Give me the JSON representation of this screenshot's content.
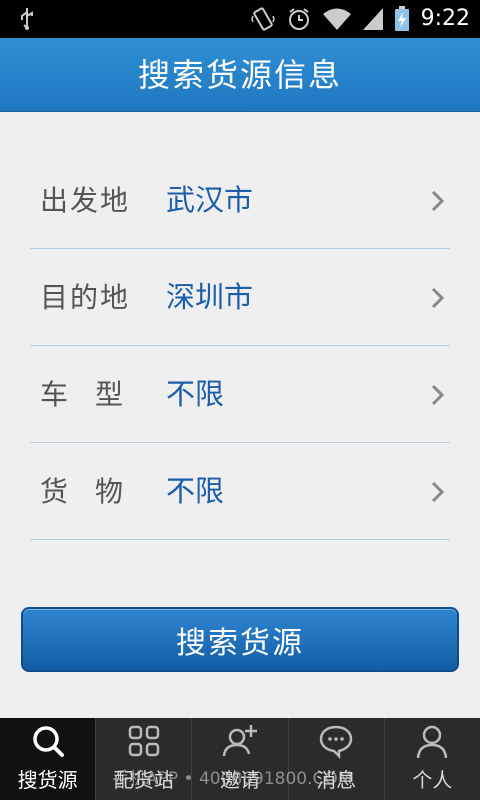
{
  "status": {
    "time": "9:22",
    "icons": [
      "usb-icon",
      "vibrate-icon",
      "alarm-icon",
      "wifi-icon",
      "signal-icon",
      "battery-charging-icon"
    ]
  },
  "header": {
    "title": "搜索货源信息"
  },
  "form": {
    "rows": [
      {
        "label": "出发地",
        "value": "武汉市"
      },
      {
        "label": "目的地",
        "value": "深圳市"
      },
      {
        "label": "车型",
        "value": "不限"
      },
      {
        "label": "货物",
        "value": "不限"
      }
    ]
  },
  "search_button": {
    "label": "搜索货源"
  },
  "tabs": [
    {
      "label": "搜货源",
      "icon": "search-icon",
      "active": true
    },
    {
      "label": "配货站",
      "icon": "grid-icon",
      "active": false
    },
    {
      "label": "邀请",
      "icon": "add-user-icon",
      "active": false
    },
    {
      "label": "消息",
      "icon": "message-icon",
      "active": false
    },
    {
      "label": "个人",
      "icon": "person-icon",
      "active": false
    }
  ],
  "watermark": "手机APP • 4008891800.COM",
  "colors": {
    "accent": "#1f78c2",
    "value_text": "#1c5ea8",
    "tabbar": "#2b2b2b"
  }
}
